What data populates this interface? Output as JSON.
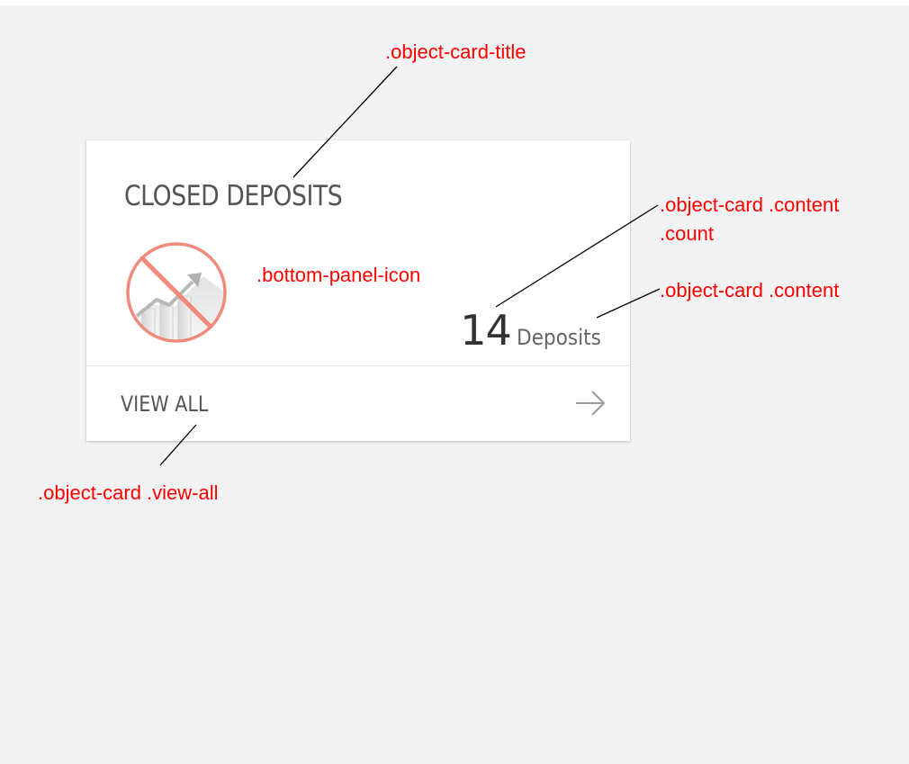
{
  "card": {
    "title": "CLOSED DEPOSITS",
    "count": "14",
    "count_unit": "Deposits",
    "view_all_label": "VIEW ALL",
    "icon": "no-deposits-chart-icon",
    "arrow_icon": "arrow-right-icon"
  },
  "annotations": {
    "title": ".object-card-title",
    "count_line1": ".object-card .content",
    "count_line2": ".count",
    "icon": ".bottom-panel-icon",
    "content": ".object-card .content",
    "view_all": ".object-card .view-all"
  },
  "colors": {
    "background": "#f3f3f3",
    "card": "#ffffff",
    "annotation": "#ff0000",
    "icon_ring": "#f08a7a",
    "icon_slash": "#f08a7a",
    "title_text": "#555555",
    "count_text": "#333333",
    "arrow": "#9a9a9a"
  }
}
